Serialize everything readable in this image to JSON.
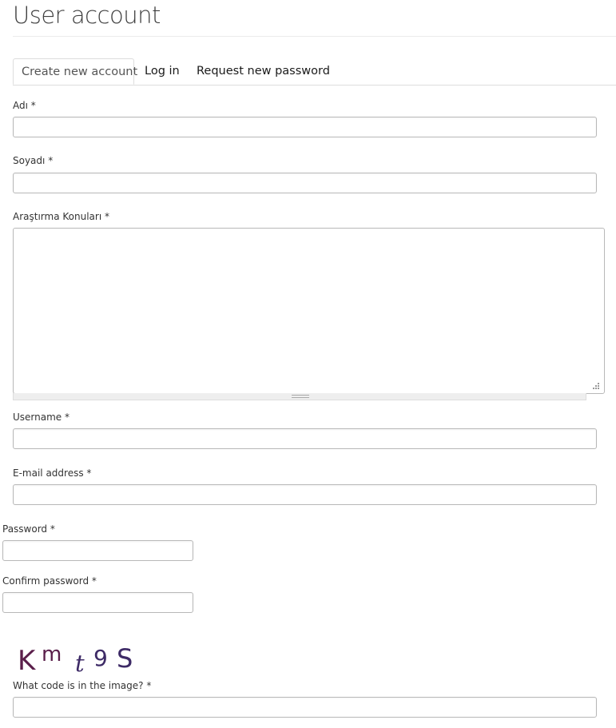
{
  "page": {
    "title": "User account"
  },
  "tabs": [
    {
      "label": "Create new account",
      "active": true
    },
    {
      "label": "Log in",
      "active": false
    },
    {
      "label": "Request new password",
      "active": false
    }
  ],
  "form": {
    "first_name": {
      "label": "Adı",
      "required_mark": "*",
      "value": ""
    },
    "last_name": {
      "label": "Soyadı",
      "required_mark": "*",
      "value": ""
    },
    "research_topics": {
      "label": "Araştırma Konuları",
      "required_mark": "*",
      "value": ""
    },
    "username": {
      "label": "Username",
      "required_mark": "*",
      "value": ""
    },
    "email": {
      "label": "E-mail address",
      "required_mark": "*",
      "value": ""
    },
    "password": {
      "label": "Password",
      "required_mark": "*",
      "value": ""
    },
    "confirm_password": {
      "label": "Confirm password",
      "required_mark": "*",
      "value": ""
    },
    "captcha": {
      "image_text": "Kmt9S",
      "label": "What code is in the image?",
      "required_mark": "*",
      "value": ""
    }
  },
  "colors": {
    "text": "#333333",
    "title": "#404040",
    "input_border": "#b8b8b8",
    "tab_border": "#dddddd",
    "captcha_glyph_1": "#5a1e4a",
    "captcha_glyph_2": "#3d2a66"
  },
  "icons": {
    "resize_corner": "resize-grip-icon",
    "grippie": "drag-handle-icon"
  }
}
